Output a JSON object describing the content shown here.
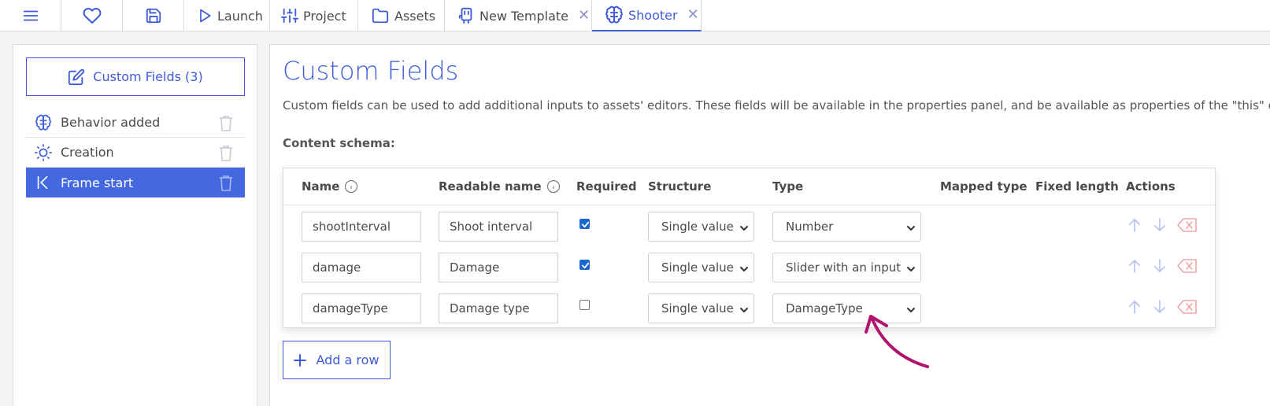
{
  "tabs": [
    {
      "id": "menu",
      "icon": "menu-icon"
    },
    {
      "id": "favorite",
      "icon": "heart-icon"
    },
    {
      "id": "save",
      "icon": "save-icon"
    },
    {
      "id": "launch",
      "icon": "play-icon",
      "label": "Launch"
    },
    {
      "id": "project",
      "icon": "sliders-icon",
      "label": "Project"
    },
    {
      "id": "assets",
      "icon": "folder-icon",
      "label": "Assets"
    },
    {
      "id": "template",
      "icon": "template-icon",
      "label": "New Template",
      "closable": true
    },
    {
      "id": "shooter",
      "icon": "brain-icon",
      "label": "Shooter",
      "closable": true,
      "active": true
    }
  ],
  "sidebar": {
    "custom_fields_button": "Custom Fields (3)",
    "events": [
      {
        "label": "Behavior added",
        "icon": "brain-icon"
      },
      {
        "label": "Creation",
        "icon": "sun-icon"
      },
      {
        "label": "Frame start",
        "icon": "skip-back-icon",
        "active": true
      }
    ]
  },
  "main": {
    "title": "Custom Fields",
    "description": "Custom fields can be used to add additional inputs to assets' editors. These fields will be available in the properties panel, and be available as properties of the \"this\" ob",
    "schema_label": "Content schema:",
    "columns": [
      "Name",
      "Readable name",
      "Required",
      "Structure",
      "Type",
      "Mapped type",
      "Fixed length",
      "Actions"
    ],
    "rows": [
      {
        "name": "shootInterval",
        "readable": "Shoot interval",
        "required": true,
        "structure": "Single value",
        "type": "Number"
      },
      {
        "name": "damage",
        "readable": "Damage",
        "required": true,
        "structure": "Single value",
        "type": "Slider with an input"
      },
      {
        "name": "damageType",
        "readable": "Damage type",
        "required": false,
        "structure": "Single value",
        "type": "DamageType"
      }
    ],
    "add_row_label": "Add a row"
  },
  "colors": {
    "accent": "#3d5bd9",
    "active_item_bg": "#4468e0",
    "annotation": "#b0146e",
    "delete": "#f0a5a5"
  }
}
